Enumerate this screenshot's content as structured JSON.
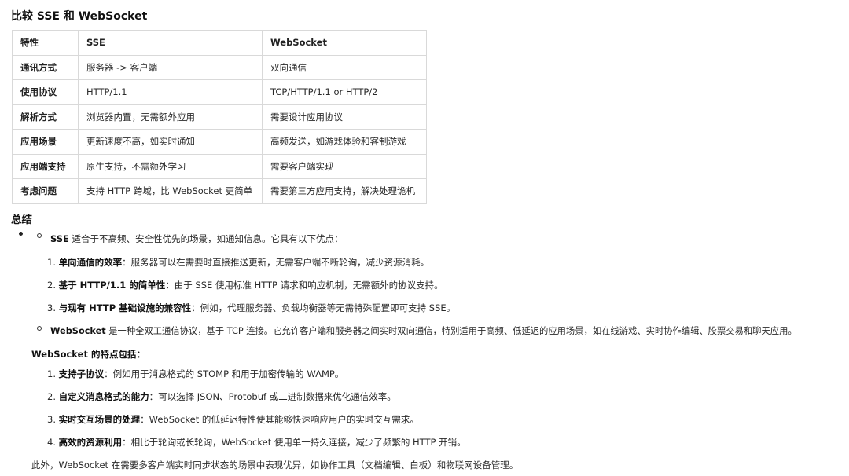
{
  "title": "比较 SSE 和 WebSocket",
  "table": {
    "headers": [
      "特性",
      "SSE",
      "WebSocket"
    ],
    "rows": [
      [
        "通讯方式",
        "服务器 -> 客户端",
        "双向通信"
      ],
      [
        "使用协议",
        "HTTP/1.1",
        "TCP/HTTP/1.1 or HTTP/2"
      ],
      [
        "解析方式",
        "浏览器内置，无需额外应用",
        "需要设计应用协议"
      ],
      [
        "应用场景",
        "更新速度不高，如实时通知",
        "高频发送，如游戏体验和客制游戏"
      ],
      [
        "应用端支持",
        "原生支持，不需额外学习",
        "需要客户端实现"
      ],
      [
        "考虑问题",
        "支持 HTTP 跨域，比 WebSocket 更简单",
        "需要第三方应用支持，解决处理诡机"
      ]
    ]
  },
  "summary": {
    "heading": "总结",
    "sse": {
      "term": "SSE",
      "desc": " 适合于不高频、安全性优先的场景，如通知信息。它具有以下优点：",
      "items": [
        {
          "num": "1. ",
          "bold": "单向通信的效率",
          "text": "：服务器可以在需要时直接推送更新，无需客户端不断轮询，减少资源消耗。"
        },
        {
          "num": "2. ",
          "bold": "基于 HTTP/1.1 的简单性",
          "text": "：由于 SSE 使用标准 HTTP 请求和响应机制，无需额外的协议支持。"
        },
        {
          "num": "3. ",
          "bold": "与现有 HTTP 基础设施的兼容性",
          "text": "：例如，代理服务器、负载均衡器等无需特殊配置即可支持 SSE。"
        }
      ]
    },
    "ws": {
      "term": "WebSocket",
      "desc": " 是一种全双工通信协议，基于 TCP 连接。它允许客户端和服务器之间实时双向通信，特别适用于高频、低延迟的应用场景，如在线游戏、实时协作编辑、股票交易和聊天应用。"
    },
    "ws_features": {
      "heading": "WebSocket 的特点包括：",
      "items": [
        {
          "num": "1. ",
          "bold": "支持子协议",
          "text": "：例如用于消息格式的 STOMP 和用于加密传输的 WAMP。"
        },
        {
          "num": "2. ",
          "bold": "自定义消息格式的能力",
          "text": "：可以选择 JSON、Protobuf 或二进制数据来优化通信效率。"
        },
        {
          "num": "3. ",
          "bold": "实时交互场景的处理",
          "text": "：WebSocket 的低延迟特性使其能够快速响应用户的实时交互需求。"
        },
        {
          "num": "4. ",
          "bold": "高效的资源利用",
          "text": "：相比于轮询或长轮询，WebSocket 使用单一持久连接，减少了频繁的 HTTP 开销。"
        }
      ]
    },
    "closing": "此外，WebSocket 在需要多客户端实时同步状态的场景中表现优异，如协作工具（文档编辑、白板）和物联网设备管理。"
  }
}
